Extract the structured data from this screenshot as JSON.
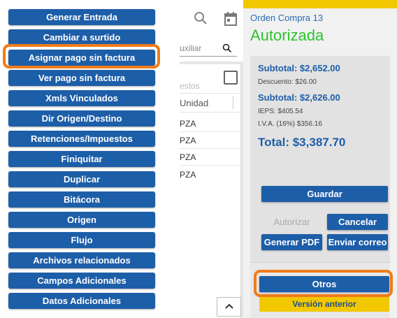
{
  "menu": {
    "items": [
      {
        "label": "Generar Entrada"
      },
      {
        "label": "Cambiar a surtido"
      },
      {
        "label": "Asignar pago sin factura"
      },
      {
        "label": "Ver pago sin factura"
      },
      {
        "label": "Xmls Vinculados"
      },
      {
        "label": "Dir Origen/Destino"
      },
      {
        "label": "Retenciones/Impuestos"
      },
      {
        "label": "Finiquitar"
      },
      {
        "label": "Duplicar"
      },
      {
        "label": "Bitácora"
      },
      {
        "label": "Origen"
      },
      {
        "label": "Flujo"
      },
      {
        "label": "Archivos relacionados"
      },
      {
        "label": "Campos Adicionales"
      },
      {
        "label": "Datos Adicionales"
      }
    ]
  },
  "grid": {
    "aux_placeholder": "uxiliar",
    "faded_header": "estos",
    "unit_header": "Unidad",
    "rows": [
      {
        "unit": "PZA"
      },
      {
        "unit": "PZA"
      },
      {
        "unit": "PZA"
      },
      {
        "unit": "PZA"
      }
    ]
  },
  "order": {
    "label": "Orden Compra 13",
    "status": "Autorizada"
  },
  "summary": {
    "subtotal1": "Subtotal: $2,652.00",
    "discount": "Descuento: $26.00",
    "subtotal2": "Subtotal: $2,626.00",
    "ieps": "IEPS: $405.54",
    "iva": "I.V.A. (16%) $356.16",
    "total": "Total: $3,387.70"
  },
  "actions": {
    "save": "Guardar",
    "authorize": "Autorizar",
    "cancel": "Cancelar",
    "pdf": "Generar PDF",
    "email": "Enviar correo",
    "others": "Otros",
    "previous_version": "Versión anterior"
  },
  "colors": {
    "button_blue": "#1d5ea8",
    "status_green": "#2ec42e",
    "highlight_orange": "#f07c1a",
    "accent_yellow": "#f2c800"
  },
  "icons": [
    "search-icon",
    "calendar-icon",
    "checkbox-icon",
    "chevron-up-icon"
  ]
}
